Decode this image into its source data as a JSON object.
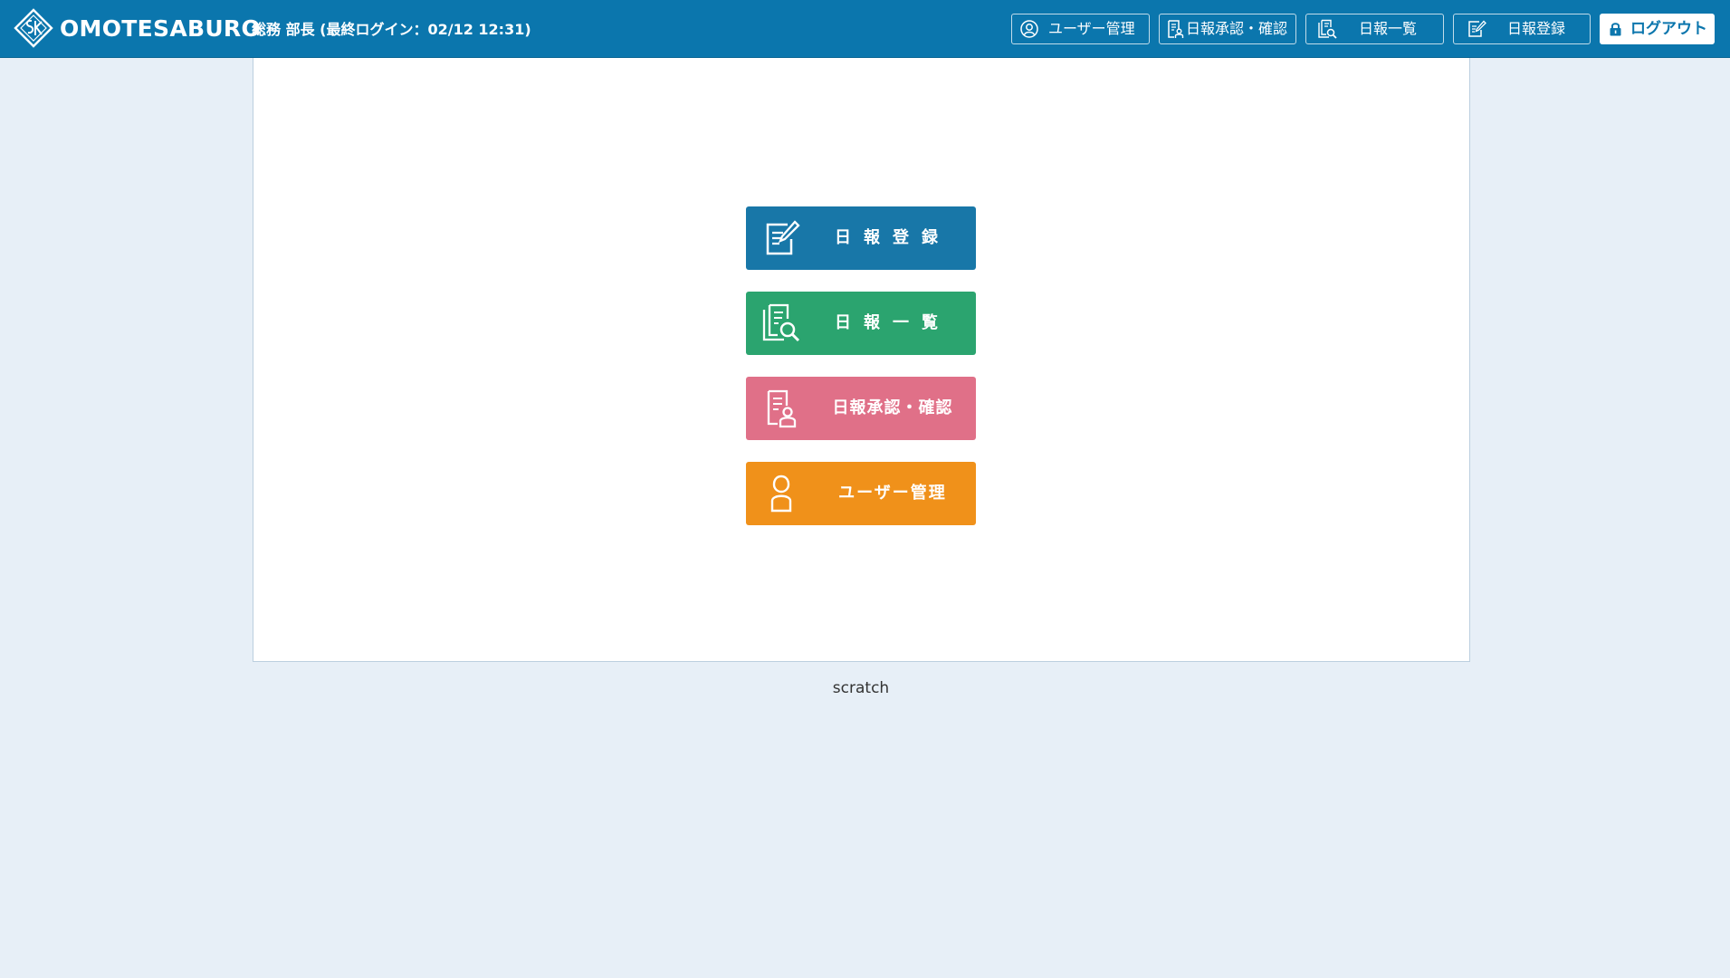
{
  "header": {
    "brand": "OMOTESABURO",
    "login_info": "総務 部長 (最終ログイン：02/12 12:31)",
    "nav": {
      "users": "ユーザー管理",
      "approve": "日報承認・確認",
      "list": "日報一覧",
      "register": "日報登録"
    },
    "logout": "ログアウト"
  },
  "main": {
    "buttons": {
      "report": "日報登録",
      "list": "日報一覧",
      "approve": "日報承認・確認",
      "users": "ユーザー管理"
    }
  },
  "footer": {
    "text": "scratch"
  },
  "icons": {
    "logo": "sk-diamond-logo",
    "nav_users": "user-circle-icon",
    "nav_approve": "document-person-icon",
    "nav_list": "document-search-icon",
    "nav_register": "document-edit-icon",
    "logout": "lock-icon"
  },
  "colors": {
    "header": "#0b76ad",
    "background": "#e7eff7",
    "report": "#1877a8",
    "list": "#2ba46f",
    "approve": "#e07088",
    "users": "#f0911a"
  }
}
